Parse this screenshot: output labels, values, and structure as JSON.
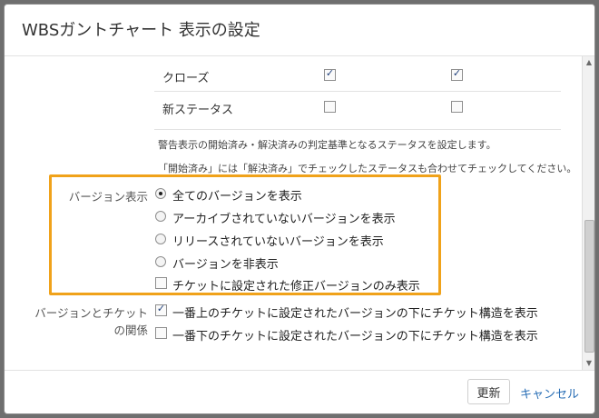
{
  "dialog": {
    "title": "WBSガントチャート  表示の設定"
  },
  "status_rows": [
    {
      "name": "クローズ",
      "col1_checked": true,
      "col2_checked": true
    },
    {
      "name": "新ステータス",
      "col1_checked": false,
      "col2_checked": false
    }
  ],
  "notes": {
    "line1": "警告表示の開始済み・解決済みの判定基準となるステータスを設定します。",
    "line2": "「開始済み」には「解決済み」でチェックしたステータスも合わせてチェックしてください。"
  },
  "version_display": {
    "label": "バージョン表示",
    "options": [
      {
        "label": "全てのバージョンを表示",
        "selected": true
      },
      {
        "label": "アーカイブされていないバージョンを表示",
        "selected": false
      },
      {
        "label": "リリースされていないバージョンを表示",
        "selected": false
      },
      {
        "label": "バージョンを非表示",
        "selected": false
      }
    ],
    "checkbox": {
      "label": "チケットに設定された修正バージョンのみ表示",
      "checked": false
    }
  },
  "version_ticket": {
    "label_line1": "バージョンとチケット",
    "label_line2": "の関係",
    "options": [
      {
        "label": "一番上のチケットに設定されたバージョンの下にチケット構造を表示",
        "checked": true
      },
      {
        "label": "一番下のチケットに設定されたバージョンの下にチケット構造を表示",
        "checked": false
      }
    ]
  },
  "footer": {
    "update_label": "更新",
    "cancel_label": "キャンセル"
  },
  "colors": {
    "highlight": "#f0a21a",
    "link": "#2a6fb6"
  }
}
